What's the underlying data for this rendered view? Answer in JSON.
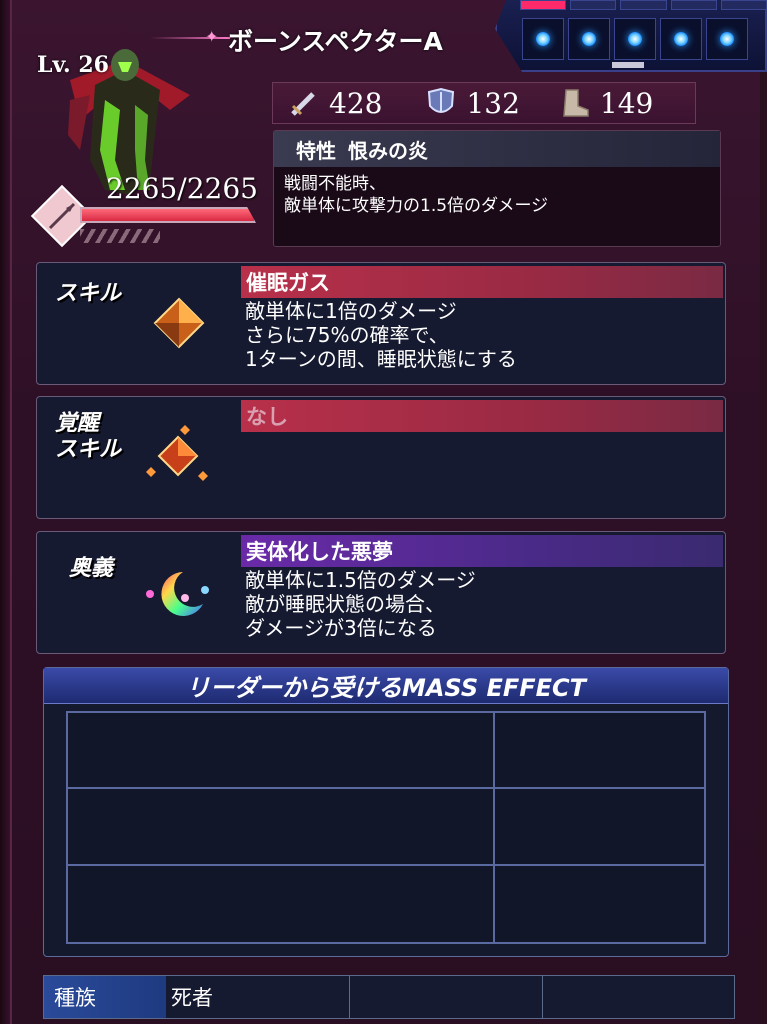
{
  "unit": {
    "name": "ボーンスペクターA",
    "level": "Lv. 26",
    "hp": "2265/2265",
    "hp_fraction": 1.0
  },
  "stats": {
    "attack": "428",
    "defense": "132",
    "speed": "149",
    "attack_icon": "sword-icon",
    "defense_icon": "shield-icon",
    "speed_icon": "boot-icon"
  },
  "trait": {
    "label": "特性",
    "name": "恨みの炎",
    "description": "戦闘不能時、\n敵単体に攻撃力の1.5倍のダメージ"
  },
  "skill": {
    "label": "スキル",
    "name": "催眠ガス",
    "description": "敵単体に1倍のダメージ\nさらに75%の確率で、\n1ターンの間、睡眠状態にする"
  },
  "awakened_skill": {
    "label": "覚醒\nスキル",
    "name": "なし",
    "description": ""
  },
  "ultimate": {
    "label": "奥義",
    "name": "実体化した悪夢",
    "description": "敵単体に1.5倍のダメージ\n敵が睡眠状態の場合、\nダメージが3倍になる"
  },
  "mass_effect": {
    "title": "リーダーから受けるMASS EFFECT",
    "rows": [
      [
        "",
        ""
      ],
      [
        "",
        ""
      ],
      [
        "",
        ""
      ]
    ]
  },
  "info": {
    "race_label": "種族",
    "race_value": "死者"
  },
  "colors": {
    "hp_bar": "#d82a44",
    "skill_header": "#b8304a",
    "ultimate_header": "#6a2aa8",
    "mass_header": "#2a3a90"
  }
}
